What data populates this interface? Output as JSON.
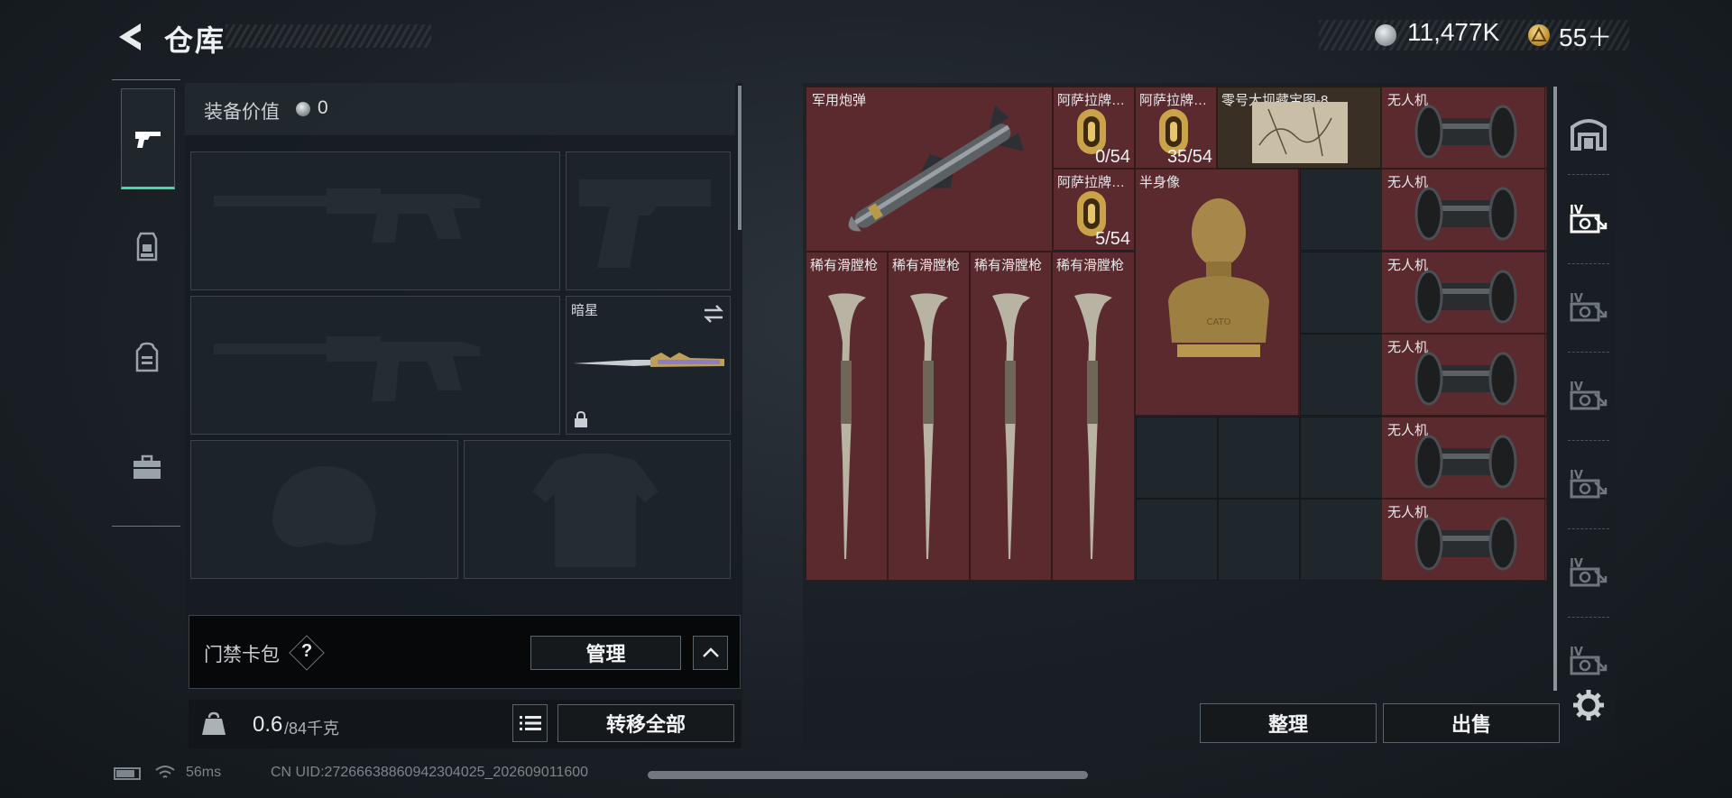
{
  "header": {
    "title": "仓库"
  },
  "currency": {
    "silver": {
      "icon": "silver-coin-icon",
      "value": "11,477K"
    },
    "gold": {
      "icon": "gold-triangle-coin-icon",
      "value": "55＋"
    }
  },
  "left_tabs": [
    {
      "icon": "pistol-icon",
      "active": true
    },
    {
      "icon": "chest-rig-icon",
      "active": false
    },
    {
      "icon": "backpack-icon",
      "active": false
    },
    {
      "icon": "toolbox-icon",
      "active": false
    }
  ],
  "equipment": {
    "value_label": "装备价值",
    "value": "0",
    "slots": [
      {
        "name": "primary-weapon-slot",
        "icon": "rifle-silhouette-icon"
      },
      {
        "name": "pistol-slot",
        "icon": "pistol-silhouette-icon"
      },
      {
        "name": "secondary-weapon-slot",
        "icon": "rifle-silhouette-icon"
      },
      {
        "name": "melee-slot",
        "label": "暗星",
        "icon": "knife-icon",
        "locked": true
      },
      {
        "name": "helmet-slot",
        "icon": "helmet-silhouette-icon"
      },
      {
        "name": "armor-slot",
        "icon": "armor-silhouette-icon"
      }
    ]
  },
  "access_card": {
    "label": "门禁卡包",
    "help": "?",
    "manage_label": "管理"
  },
  "weight": {
    "current": "0.6",
    "max": "/84千克",
    "transfer_label": "转移全部"
  },
  "stash": {
    "items": [
      {
        "label": "军用炮弹",
        "icon": "missile-icon"
      },
      {
        "label": "阿萨拉牌…",
        "count": "0/54",
        "icon": "gold-capsule-icon"
      },
      {
        "label": "阿萨拉牌…",
        "count": "35/54",
        "icon": "gold-capsule-icon"
      },
      {
        "label": "零号大坝藏宝图-8",
        "icon": "treasure-map-icon"
      },
      {
        "label": "阿萨拉牌…",
        "count": "5/54",
        "icon": "gold-capsule-icon"
      },
      {
        "label": "半身像",
        "icon": "bust-statue-icon"
      },
      {
        "label": "稀有滑膛枪",
        "icon": "musket-icon"
      },
      {
        "label": "稀有滑膛枪",
        "icon": "musket-icon"
      },
      {
        "label": "稀有滑膛枪",
        "icon": "musket-icon"
      },
      {
        "label": "稀有滑膛枪",
        "icon": "musket-icon"
      },
      {
        "label": "无人机",
        "icon": "drone-barrel-icon"
      },
      {
        "label": "无人机",
        "icon": "drone-barrel-icon"
      },
      {
        "label": "无人机",
        "icon": "drone-barrel-icon"
      },
      {
        "label": "无人机",
        "icon": "drone-barrel-icon"
      },
      {
        "label": "无人机",
        "icon": "drone-barrel-icon"
      },
      {
        "label": "无人机",
        "icon": "drone-barrel-icon"
      }
    ],
    "sort_label": "整理",
    "sell_label": "出售"
  },
  "right_tabs": [
    {
      "icon": "stash-home-icon"
    },
    {
      "icon": "stash-page-IV-icon",
      "active": true
    },
    {
      "icon": "stash-page-IV-icon"
    },
    {
      "icon": "stash-page-IV-icon"
    },
    {
      "icon": "stash-page-IV-icon"
    },
    {
      "icon": "stash-page-IV-icon"
    },
    {
      "icon": "stash-page-IV-icon"
    },
    {
      "icon": "gear-icon"
    }
  ],
  "status": {
    "ping": "56ms",
    "uid": "CN UID:2726663886094230402­5_202609011600"
  },
  "colors": {
    "accent": "#49d6a8",
    "item_red": "#5a2a2e",
    "bg": "#1b2127"
  }
}
